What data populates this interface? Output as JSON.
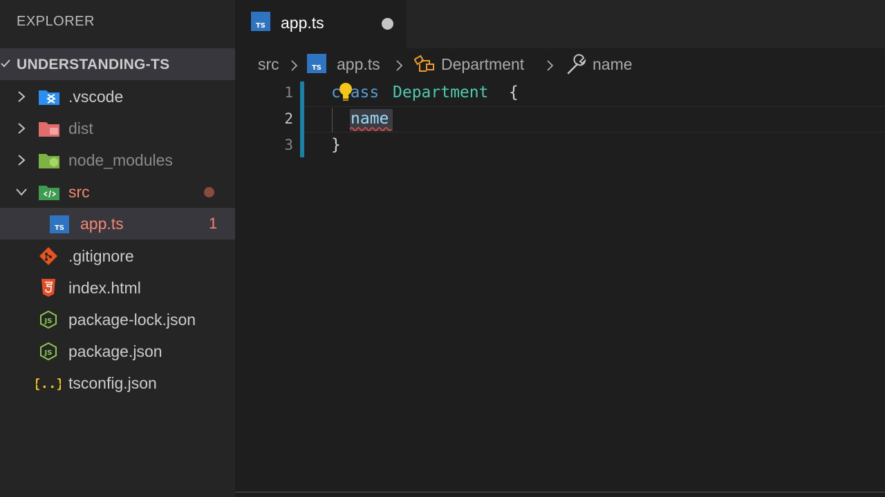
{
  "sidebar": {
    "title": "EXPLORER",
    "project": "UNDERSTANDING-TS",
    "items": [
      {
        "label": ".vscode",
        "icon": "vscode-folder-icon"
      },
      {
        "label": "dist",
        "icon": "dist-folder-icon"
      },
      {
        "label": "node_modules",
        "icon": "node-folder-icon"
      },
      {
        "label": "src",
        "icon": "src-folder-icon"
      },
      {
        "label": "app.ts",
        "icon": "typescript-file-icon",
        "problems": "1"
      },
      {
        "label": ".gitignore",
        "icon": "git-icon"
      },
      {
        "label": "index.html",
        "icon": "html5-icon"
      },
      {
        "label": "package-lock.json",
        "icon": "nodejs-icon"
      },
      {
        "label": "package.json",
        "icon": "nodejs-icon"
      },
      {
        "label": "tsconfig.json",
        "icon": "json-braces-icon"
      }
    ]
  },
  "tab": {
    "label": "app.ts",
    "icon_text": "TS"
  },
  "breadcrumb": {
    "folder": "src",
    "file": "app.ts",
    "class": "Department",
    "property": "name"
  },
  "editor": {
    "line_numbers": [
      "1",
      "2",
      "3"
    ],
    "line1_keyword": "class",
    "line1_name": "Department",
    "line1_brace": "{",
    "line2_prop": "name",
    "line3_brace": "}"
  },
  "colors": {
    "accent": "#1b81a8",
    "error": "#f48771",
    "keyword": "#569cd6",
    "type": "#4ec9b0",
    "property": "#9cdcfe"
  }
}
